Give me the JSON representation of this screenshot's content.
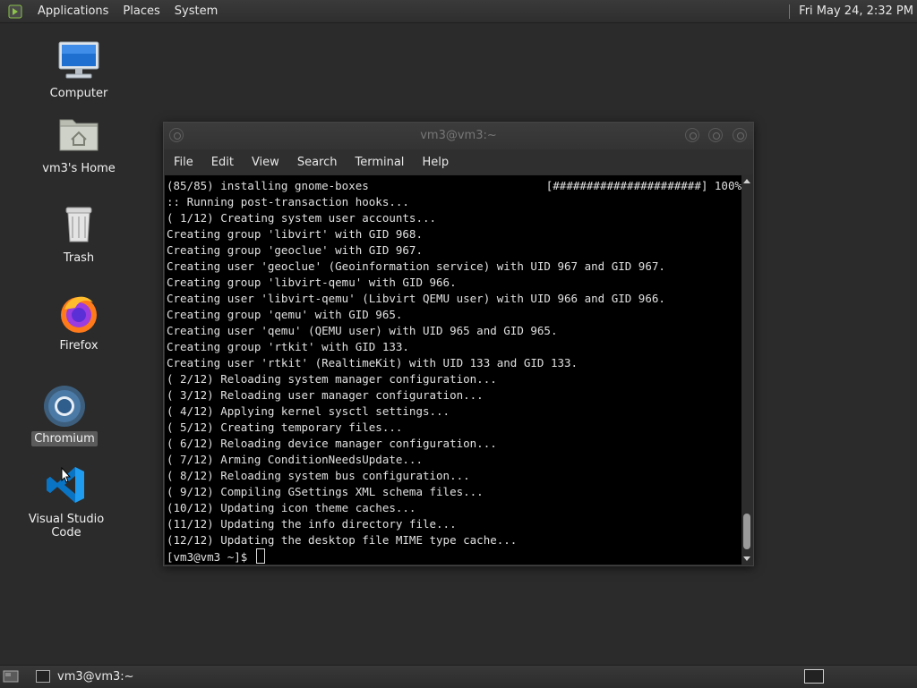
{
  "top_panel": {
    "menus": [
      "Applications",
      "Places",
      "System"
    ],
    "clock": "Fri May 24,  2:32 PM"
  },
  "desktop_icons": [
    {
      "label": "Computer",
      "icon": "computer-icon"
    },
    {
      "label": "vm3's Home",
      "icon": "home-folder-icon"
    },
    {
      "label": "Trash",
      "icon": "trash-icon"
    },
    {
      "label": "Firefox",
      "icon": "firefox-icon"
    },
    {
      "label": "Chromium",
      "icon": "chromium-icon",
      "selected": true
    },
    {
      "label": "Visual Studio Code",
      "icon": "vscode-icon"
    }
  ],
  "terminal": {
    "title": "vm3@vm3:~",
    "menu": [
      "File",
      "Edit",
      "View",
      "Search",
      "Terminal",
      "Help"
    ],
    "progress_line": {
      "text": "(85/85) installing gnome-boxes",
      "bar": "[######################] 100%"
    },
    "lines": [
      ":: Running post-transaction hooks...",
      "( 1/12) Creating system user accounts...",
      "Creating group 'libvirt' with GID 968.",
      "Creating group 'geoclue' with GID 967.",
      "Creating user 'geoclue' (Geoinformation service) with UID 967 and GID 967.",
      "Creating group 'libvirt-qemu' with GID 966.",
      "Creating user 'libvirt-qemu' (Libvirt QEMU user) with UID 966 and GID 966.",
      "Creating group 'qemu' with GID 965.",
      "Creating user 'qemu' (QEMU user) with UID 965 and GID 965.",
      "Creating group 'rtkit' with GID 133.",
      "Creating user 'rtkit' (RealtimeKit) with UID 133 and GID 133.",
      "( 2/12) Reloading system manager configuration...",
      "( 3/12) Reloading user manager configuration...",
      "( 4/12) Applying kernel sysctl settings...",
      "( 5/12) Creating temporary files...",
      "( 6/12) Reloading device manager configuration...",
      "( 7/12) Arming ConditionNeedsUpdate...",
      "( 8/12) Reloading system bus configuration...",
      "( 9/12) Compiling GSettings XML schema files...",
      "(10/12) Updating icon theme caches...",
      "(11/12) Updating the info directory file...",
      "(12/12) Updating the desktop file MIME type cache..."
    ],
    "prompt": "[vm3@vm3 ~]$ "
  },
  "bottom_panel": {
    "task_label": "vm3@vm3:~"
  }
}
